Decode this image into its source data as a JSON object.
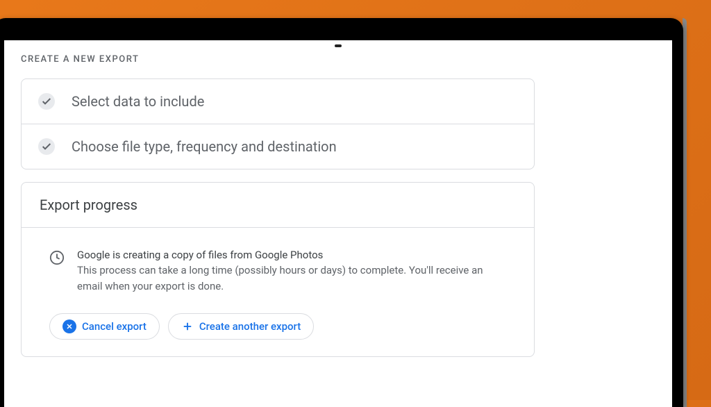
{
  "page": {
    "title": "CREATE A NEW EXPORT"
  },
  "steps": [
    {
      "label": "Select data to include",
      "completed": true
    },
    {
      "label": "Choose file type, frequency and destination",
      "completed": true
    }
  ],
  "progress": {
    "title": "Export progress",
    "message": "Google is creating a copy of files from Google Photos",
    "description": "This process can take a long time (possibly hours or days) to complete. You'll receive an email when your export is done."
  },
  "buttons": {
    "cancel": "Cancel export",
    "createAnother": "Create another export"
  }
}
